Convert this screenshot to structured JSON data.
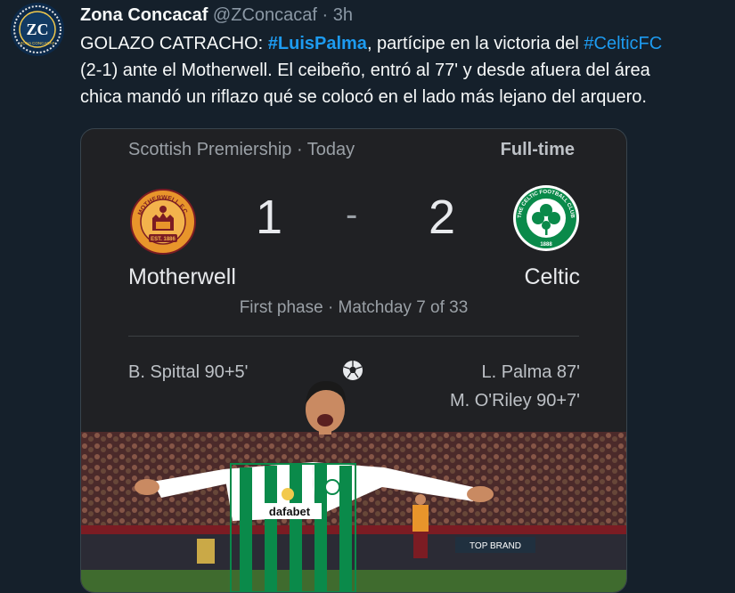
{
  "account": {
    "name": "Zona Concacaf",
    "handle": "@ZConcacaf",
    "time": "· 3h",
    "avatar_text": "ZC",
    "avatar_subtext": "ZONA CONCACAF"
  },
  "tweet": {
    "line1_pre": "GOLAZO CATRACHO: ",
    "hashtag1": "#LuisPalma",
    "line1_mid": ", partícipe en la victoria del ",
    "hashtag2": "#CelticFC",
    "line2": "(2-1) ante el Motherwell. El ceibeño, entró al 77' y desde afuera del área",
    "line3": "chica mandó un riflazo qué se colocó en el lado más lejano del arquero."
  },
  "match": {
    "league_line": "Scottish Premiership · Today",
    "status": "Full-time",
    "home": {
      "name": "Motherwell",
      "score": "1",
      "crest_top": "MOTHERWELL F.C.",
      "crest_bottom": "EST. 1886"
    },
    "away": {
      "name": "Celtic",
      "score": "2",
      "crest_text": "THE CELTIC FOOTBALL CLUB",
      "crest_year": "1888"
    },
    "separator": "-",
    "phase": "First phase · Matchday 7 of 33",
    "home_scorers": [
      "B. Spittal 90+5'"
    ],
    "away_scorers": [
      "L. Palma 87'",
      "M. O'Riley 90+7'"
    ]
  },
  "photo": {
    "shirt_sponsor": "dafabet",
    "ad_board": "TOP BRAND"
  },
  "colors": {
    "background": "#15202b",
    "link": "#1d9bf0",
    "card": "#202124",
    "motherwell_amber": "#e8952b",
    "motherwell_claret": "#7b1c23",
    "celtic_green": "#0a8a4a"
  },
  "icons": {
    "goal": "soccer-ball-icon"
  }
}
